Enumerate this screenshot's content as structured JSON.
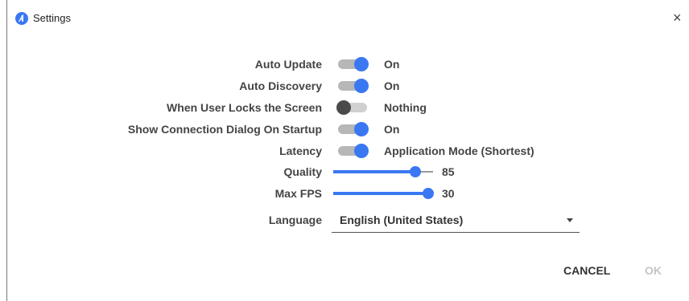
{
  "window": {
    "title": "Settings",
    "close_glyph": "×",
    "icon": "app-logo-icon",
    "accent_color": "#3a78f2"
  },
  "settings": {
    "auto_update": {
      "label": "Auto Update",
      "state": true,
      "value": "On"
    },
    "auto_discovery": {
      "label": "Auto Discovery",
      "state": true,
      "value": "On"
    },
    "lock_screen": {
      "label": "When User Locks the Screen",
      "state": false,
      "value": "Nothing"
    },
    "connection_dialog": {
      "label": "Show Connection Dialog On Startup",
      "state": true,
      "value": "On"
    },
    "latency": {
      "label": "Latency",
      "state": true,
      "value": "Application Mode (Shortest)"
    },
    "quality": {
      "label": "Quality",
      "value": "85",
      "percent": 82
    },
    "max_fps": {
      "label": "Max FPS",
      "value": "30",
      "percent": 95
    },
    "language": {
      "label": "Language",
      "selected": "English (United States)"
    }
  },
  "buttons": {
    "cancel": "CANCEL",
    "ok": "OK"
  }
}
